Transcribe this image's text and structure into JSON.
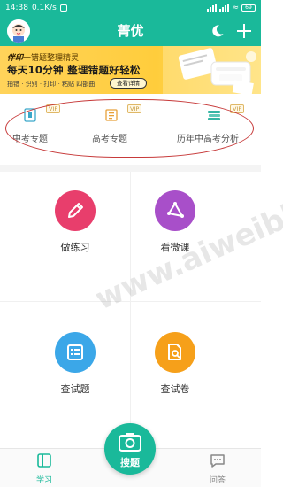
{
  "status_bar": {
    "time": "14:38",
    "speed": "0.1K/s",
    "battery": "69"
  },
  "header": {
    "title": "菁优"
  },
  "banner": {
    "brand_name": "伴印",
    "brand_tagline": "一错题整理精灵",
    "headline": "每天10分钟  整理错题好轻松",
    "tags": "拍错 · 识别 · 打印 · 粘贴 四部曲",
    "button_label": "查看详情"
  },
  "topics": [
    {
      "label": "中考专题",
      "badge": "VIP",
      "icon": "book-icon"
    },
    {
      "label": "高考专题",
      "badge": "VIP",
      "icon": "scroll-icon"
    },
    {
      "label": "历年中高考分析",
      "badge": "VIP",
      "icon": "books-stack-icon"
    }
  ],
  "features": [
    {
      "label": "做练习",
      "icon": "pencil-icon",
      "color": "#e83e6c"
    },
    {
      "label": "看微课",
      "icon": "triangle-icon",
      "color": "#a84fc9"
    },
    {
      "label": "查试题",
      "icon": "list-icon",
      "color": "#3ba7e8"
    },
    {
      "label": "查试卷",
      "icon": "document-search-icon",
      "color": "#f6a01a"
    }
  ],
  "bottom_nav": {
    "study_label": "学习",
    "search_label": "搜题",
    "qa_label": "问答"
  },
  "watermark": {
    "text": "www.aiweibk.com"
  },
  "colors": {
    "brand": "#1ab99a",
    "annotation": "#c73a3a"
  }
}
